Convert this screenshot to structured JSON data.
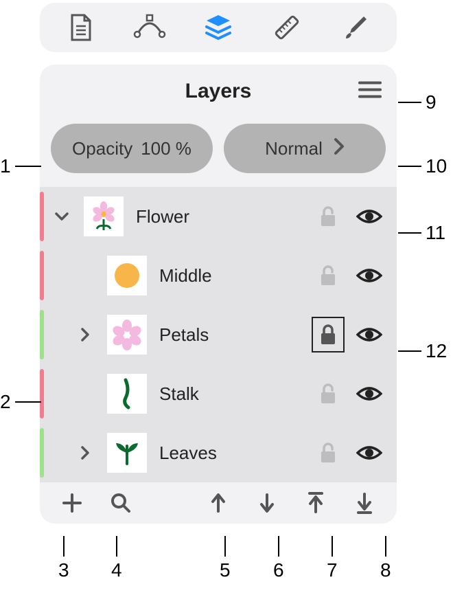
{
  "toolbar": {
    "tabs": [
      "document",
      "path",
      "layers",
      "ruler",
      "brush"
    ],
    "active_index": 2
  },
  "panel": {
    "title": "Layers",
    "opacity": {
      "label": "Opacity",
      "value": "100 %"
    },
    "blend": {
      "label": "Normal"
    }
  },
  "layers": [
    {
      "name": "Flower",
      "color": "#f27d8f",
      "expanded": true,
      "has_children": true,
      "locked": false,
      "visible": true,
      "thumb": "flower",
      "indent": 0
    },
    {
      "name": "Middle",
      "color": "#f27d8f",
      "expanded": false,
      "has_children": false,
      "locked": false,
      "visible": true,
      "thumb": "circle",
      "indent": 1
    },
    {
      "name": "Petals",
      "color": "#9de28a",
      "expanded": false,
      "has_children": true,
      "locked": true,
      "visible": true,
      "thumb": "petals",
      "indent": 1
    },
    {
      "name": "Stalk",
      "color": "#f27d8f",
      "expanded": false,
      "has_children": false,
      "locked": false,
      "visible": true,
      "thumb": "stalk",
      "indent": 1
    },
    {
      "name": "Leaves",
      "color": "#9de28a",
      "expanded": false,
      "has_children": true,
      "locked": false,
      "visible": true,
      "thumb": "leaves",
      "indent": 1
    }
  ],
  "bottom_bar": {
    "buttons": [
      "add",
      "search",
      "move-up",
      "move-down",
      "move-to-top",
      "move-to-bottom"
    ]
  },
  "annotations": {
    "1": "1",
    "2": "2",
    "3": "3",
    "4": "4",
    "5": "5",
    "6": "6",
    "7": "7",
    "8": "8",
    "9": "9",
    "10": "10",
    "11": "11",
    "12": "12"
  }
}
